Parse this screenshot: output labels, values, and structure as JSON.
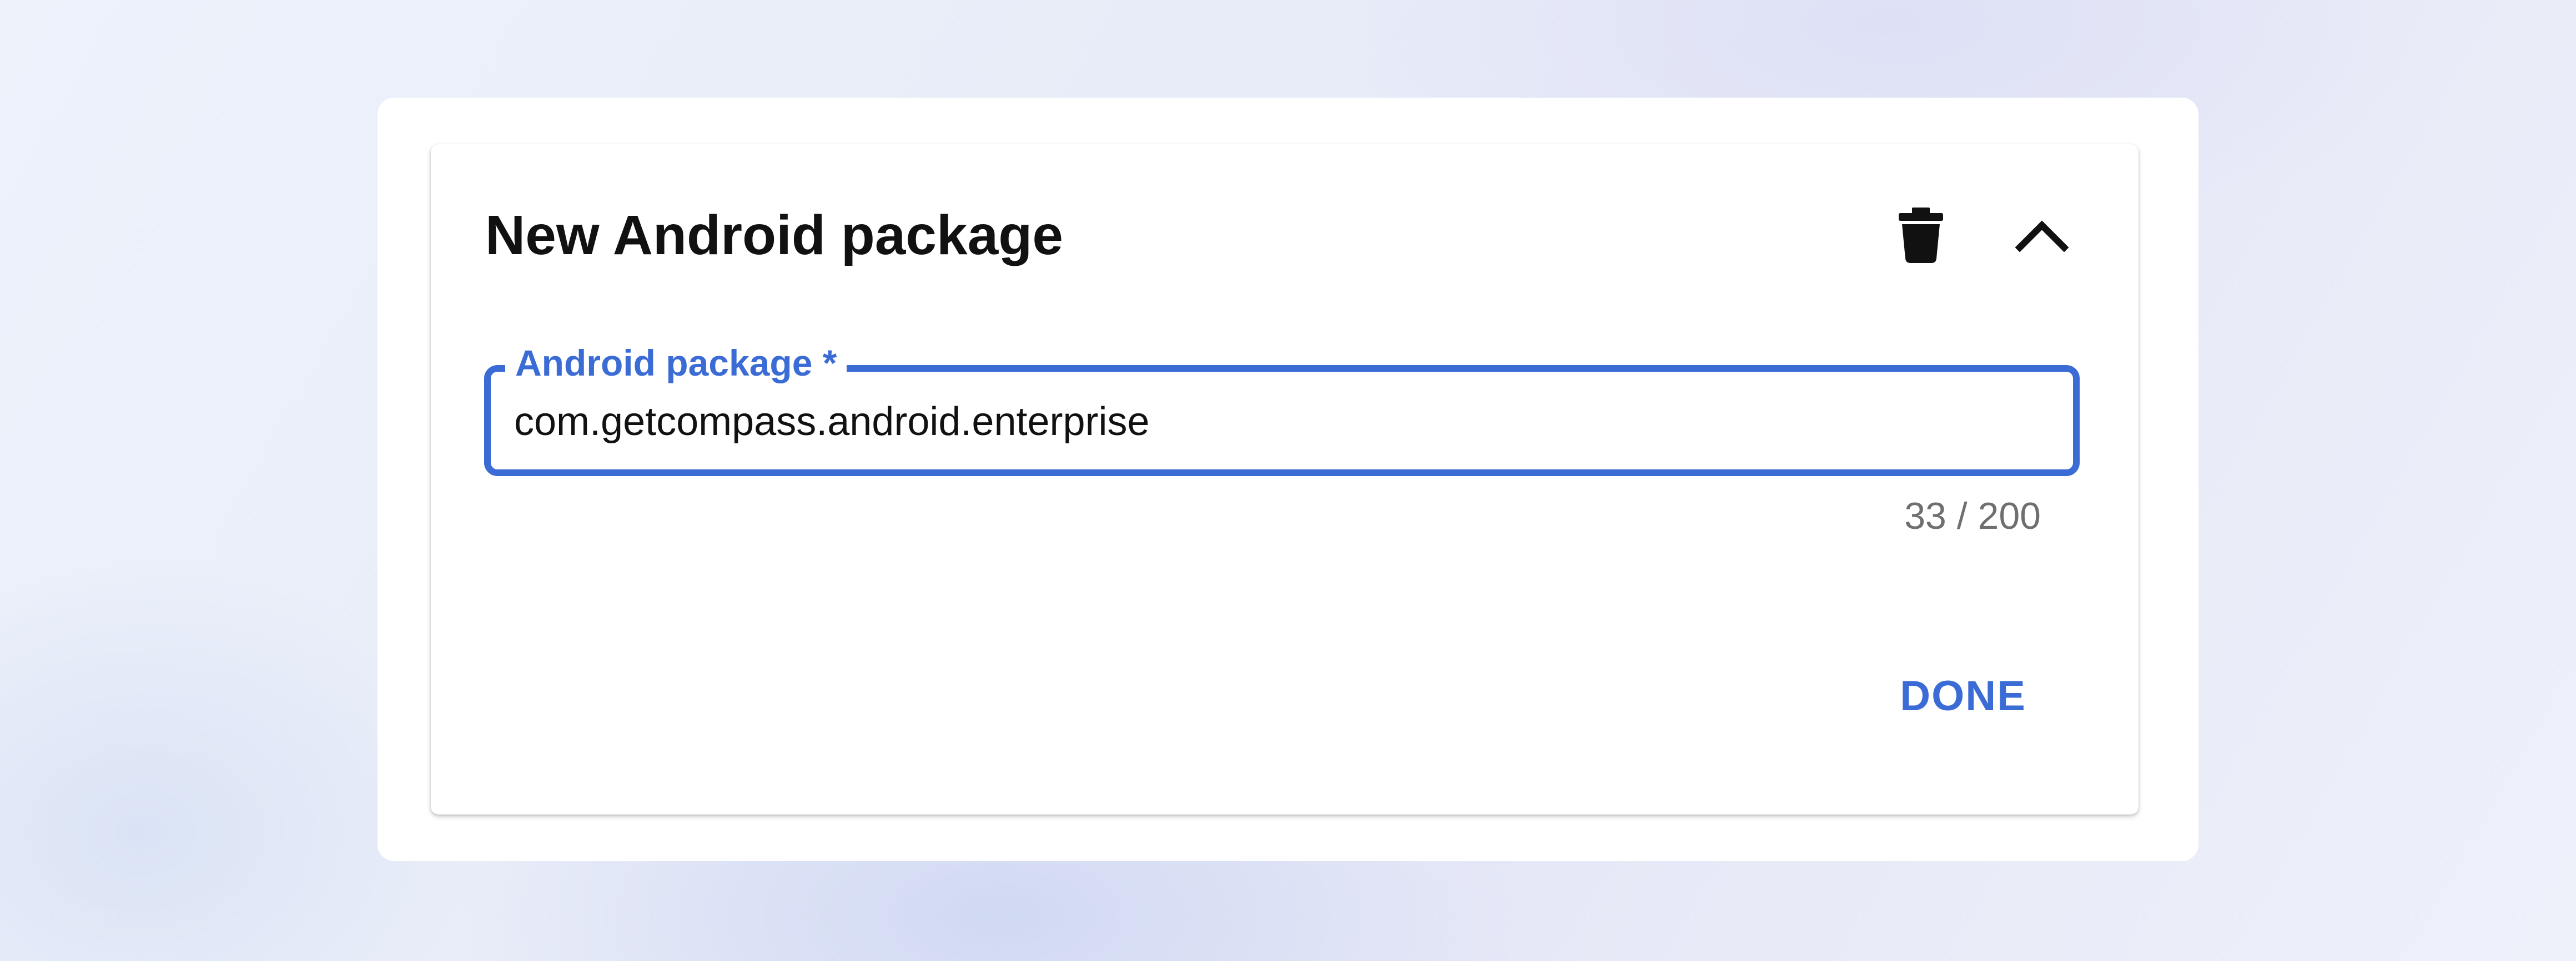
{
  "card": {
    "title": "New Android package",
    "actions": {
      "delete_icon": "delete-icon",
      "collapse_icon": "chevron-up-icon"
    }
  },
  "field": {
    "label": "Android package *",
    "value": "com.getcompass.android.enterprise",
    "counter": "33 / 200"
  },
  "footer": {
    "done_label": "DONE"
  },
  "colors": {
    "accent": "#3b6cd6",
    "title_text": "#111111",
    "counter_text": "#6f6f6f",
    "card_background": "#ffffff"
  }
}
